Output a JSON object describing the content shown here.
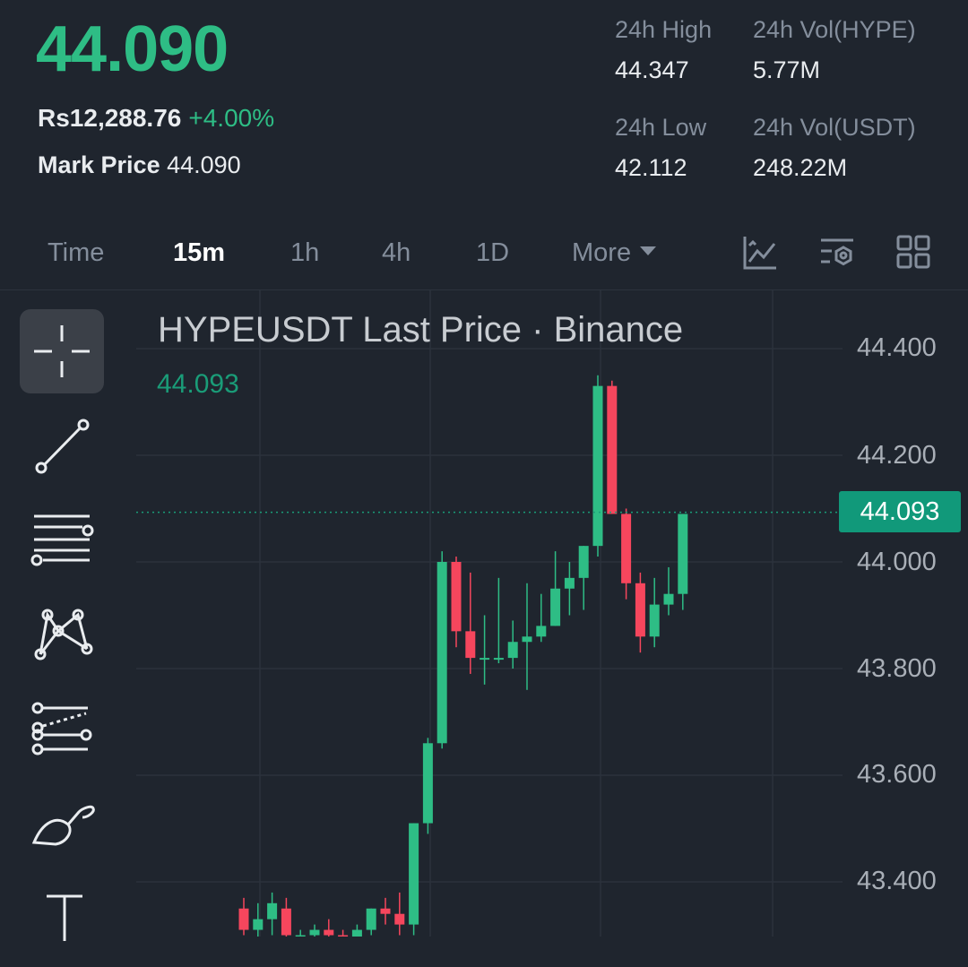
{
  "ticker": {
    "last_price": "44.090",
    "fiat_price": "Rs12,288.76",
    "change_pct": "+4.00%",
    "mark_label": "Mark Price",
    "mark_value": "44.090",
    "stats": {
      "high_label": "24h High",
      "high_value": "44.347",
      "vol_base_label": "24h Vol(HYPE)",
      "vol_base_value": "5.77M",
      "low_label": "24h Low",
      "low_value": "42.112",
      "vol_quote_label": "24h Vol(USDT)",
      "vol_quote_value": "248.22M"
    }
  },
  "intervals": {
    "time": "Time",
    "m15": "15m",
    "h1": "1h",
    "h4": "4h",
    "d1": "1D",
    "more": "More",
    "active": "15m"
  },
  "toolbar_icons": [
    "indicator-chart-icon",
    "chart-settings-icon",
    "layout-grid-icon"
  ],
  "drawing_tools": [
    "crosshair-icon",
    "trendline-icon",
    "horizontal-lines-icon",
    "pattern-icon",
    "fib-channel-icon",
    "brush-icon",
    "text-icon"
  ],
  "chart": {
    "title": "HYPEUSDT Last Price · Binance",
    "last_label": "44.093",
    "price_tag": "44.093"
  },
  "colors": {
    "up": "#2ebd85",
    "down": "#f6465d",
    "bg": "#1f252e",
    "accent_tag": "#11997a"
  },
  "chart_data": {
    "type": "candlestick",
    "title": "HYPEUSDT Last Price · Binance",
    "interval": "15m",
    "y_ticks": [
      "44.400",
      "44.200",
      "44.000",
      "43.800",
      "43.600",
      "43.400"
    ],
    "ylim": [
      43.3,
      44.43
    ],
    "last_price": 44.093,
    "grid": true,
    "candles": [
      {
        "o": 43.35,
        "h": 43.37,
        "l": 43.3,
        "c": 43.31
      },
      {
        "o": 43.31,
        "h": 43.36,
        "l": 43.29,
        "c": 43.33
      },
      {
        "o": 43.33,
        "h": 43.38,
        "l": 43.3,
        "c": 43.36
      },
      {
        "o": 43.35,
        "h": 43.37,
        "l": 43.28,
        "c": 43.3
      },
      {
        "o": 43.3,
        "h": 43.31,
        "l": 43.29,
        "c": 43.3
      },
      {
        "o": 43.3,
        "h": 43.32,
        "l": 43.29,
        "c": 43.31
      },
      {
        "o": 43.31,
        "h": 43.33,
        "l": 43.29,
        "c": 43.3
      },
      {
        "o": 43.3,
        "h": 43.31,
        "l": 43.28,
        "c": 43.29
      },
      {
        "o": 43.29,
        "h": 43.32,
        "l": 43.28,
        "c": 43.31
      },
      {
        "o": 43.31,
        "h": 43.35,
        "l": 43.3,
        "c": 43.35
      },
      {
        "o": 43.35,
        "h": 43.37,
        "l": 43.32,
        "c": 43.34
      },
      {
        "o": 43.34,
        "h": 43.38,
        "l": 43.3,
        "c": 43.32
      },
      {
        "o": 43.32,
        "h": 43.51,
        "l": 43.3,
        "c": 43.51
      },
      {
        "o": 43.51,
        "h": 43.67,
        "l": 43.49,
        "c": 43.66
      },
      {
        "o": 43.66,
        "h": 44.02,
        "l": 43.65,
        "c": 44.0
      },
      {
        "o": 44.0,
        "h": 44.01,
        "l": 43.84,
        "c": 43.87
      },
      {
        "o": 43.87,
        "h": 43.98,
        "l": 43.79,
        "c": 43.82
      },
      {
        "o": 43.82,
        "h": 43.9,
        "l": 43.77,
        "c": 43.82
      },
      {
        "o": 43.82,
        "h": 43.97,
        "l": 43.81,
        "c": 43.82
      },
      {
        "o": 43.82,
        "h": 43.89,
        "l": 43.8,
        "c": 43.85
      },
      {
        "o": 43.85,
        "h": 43.96,
        "l": 43.76,
        "c": 43.86
      },
      {
        "o": 43.86,
        "h": 43.94,
        "l": 43.85,
        "c": 43.88
      },
      {
        "o": 43.88,
        "h": 44.02,
        "l": 43.88,
        "c": 43.95
      },
      {
        "o": 43.95,
        "h": 44.0,
        "l": 43.9,
        "c": 43.97
      },
      {
        "o": 43.97,
        "h": 44.03,
        "l": 43.91,
        "c": 44.03
      },
      {
        "o": 44.03,
        "h": 44.35,
        "l": 44.01,
        "c": 44.33
      },
      {
        "o": 44.33,
        "h": 44.34,
        "l": 44.09,
        "c": 44.09
      },
      {
        "o": 44.09,
        "h": 44.1,
        "l": 43.93,
        "c": 43.96
      },
      {
        "o": 43.96,
        "h": 43.98,
        "l": 43.83,
        "c": 43.86
      },
      {
        "o": 43.86,
        "h": 43.97,
        "l": 43.84,
        "c": 43.92
      },
      {
        "o": 43.92,
        "h": 43.99,
        "l": 43.9,
        "c": 43.94
      },
      {
        "o": 43.94,
        "h": 44.09,
        "l": 43.91,
        "c": 44.09
      }
    ]
  }
}
